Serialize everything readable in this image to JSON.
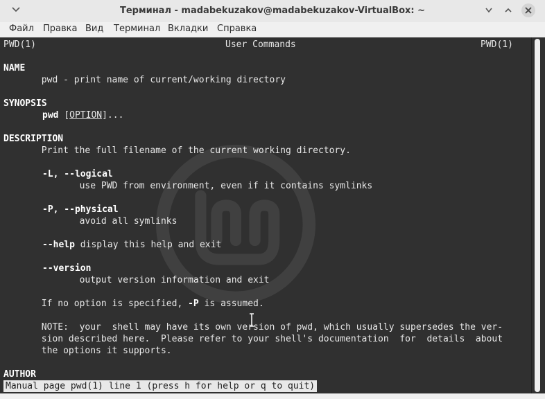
{
  "window": {
    "title": "Терминал - madabekuzakov@madabekuzakov-VirtualBox: ~"
  },
  "menu": {
    "items": [
      "Файл",
      "Правка",
      "Вид",
      "Терминал",
      "Вкладки",
      "Справка"
    ]
  },
  "terminal": {
    "header_left": "PWD(1)",
    "header_center": "User Commands",
    "header_right": "PWD(1)",
    "name_heading": "NAME",
    "name_text": "       pwd - print name of current/working directory",
    "synopsis_heading": "SYNOPSIS",
    "synopsis_cmd": "pwd",
    "synopsis_open": "[",
    "synopsis_option": "OPTION",
    "synopsis_close": "]...",
    "description_heading": "DESCRIPTION",
    "description_text": "       Print the full filename of the current working directory.",
    "opt_l_flag": "-L, --logical",
    "opt_l_desc": "              use PWD from environment, even if it contains symlinks",
    "opt_p_flag": "-P, --physical",
    "opt_p_desc": "              avoid all symlinks",
    "opt_help_flag": "--help",
    "opt_help_desc": " display this help and exit",
    "opt_version_flag": "--version",
    "opt_version_desc": "              output version information and exit",
    "default_pre": "       If no option is specified, ",
    "default_flag": "-P",
    "default_post": " is assumed.",
    "note_line1": "       NOTE:  your  shell may have its own version of pwd, which usually supersedes the ver-",
    "note_line2": "       sion described here.  Please refer to your shell's documentation  for  details  about",
    "note_line3": "       the options it supports.",
    "author_heading": "AUTHOR",
    "status_line": "Manual page pwd(1) line 1 (press h for help or q to quit)"
  },
  "icons": {
    "menu_chevron": "chevron-down-icon",
    "minimize": "minimize-icon",
    "maximize": "maximize-icon",
    "close": "close-icon",
    "watermark": "linux-mint-logo-icon",
    "text_cursor": "ibeam-cursor-icon"
  }
}
